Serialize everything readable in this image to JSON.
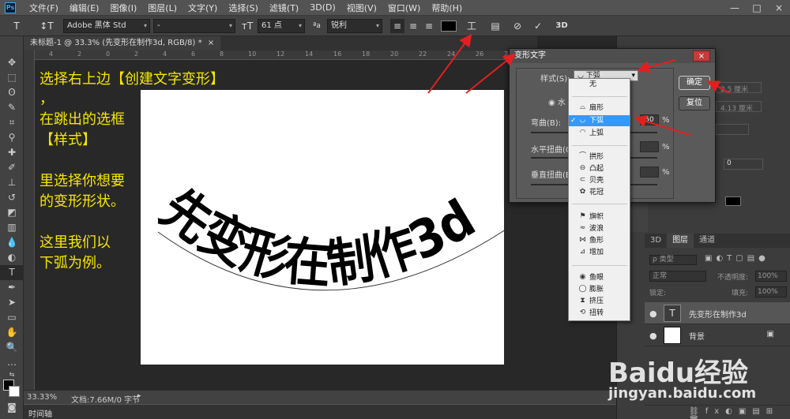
{
  "menubar": {
    "items": [
      "文件(F)",
      "编辑(E)",
      "图像(I)",
      "图层(L)",
      "文字(Y)",
      "选择(S)",
      "滤镜(T)",
      "3D(D)",
      "视图(V)",
      "窗口(W)",
      "帮助(H)"
    ],
    "app_badge": "Ps",
    "win_min": "—",
    "win_max": "□",
    "win_close": "×"
  },
  "options": {
    "font_family": "Adobe 黑体 Std",
    "font_style": "-",
    "font_size": "61 点",
    "aa_label": "ªa",
    "anti_alias": "锐利",
    "threed": "3D",
    "color_swatch": "#000000"
  },
  "document": {
    "tab_title": "未标题-1 @ 33.3% (先变形在制作3d, RGB/8) *",
    "close": "×",
    "zoom": "33.33%",
    "doc_info": "文档:7.66M/0 字节",
    "warped_text": "先变形在制作3d",
    "ruler_ticks": [
      "4",
      "2",
      "0",
      "2",
      "4",
      "6",
      "8",
      "10",
      "12",
      "14",
      "16",
      "18",
      "20",
      "22",
      "24",
      "26",
      "28",
      "30",
      "32",
      "34",
      "36"
    ]
  },
  "instructions": {
    "line1": "选择右上边【创建文字变形】",
    "line2": "，",
    "line3": "在跳出的选框",
    "line4": "【样式】",
    "line5": "里选择你想要",
    "line6": "的变形形状。",
    "line7": "这里我们以",
    "line8": "下弧为例。"
  },
  "dialog": {
    "title": "变形文字",
    "style_label": "样式(S):",
    "style_value": "下弧",
    "horizontal_label": "水",
    "bend_label": "弯曲(B):",
    "bend_value": "-50",
    "percent": "%",
    "h_distort_label": "水平扭曲(O",
    "v_distort_label": "垂直扭曲(E",
    "ok": "确定",
    "reset": "复位",
    "close": "×",
    "ghost_1": "2.5 厘米",
    "ghost_2": "4.13 厘米",
    "ghost_3": "0"
  },
  "style_menu": {
    "items": [
      {
        "label": "无",
        "icon": ""
      },
      {
        "label": "扇形",
        "icon": "⌓"
      },
      {
        "label": "下弧",
        "icon": "◡"
      },
      {
        "label": "上弧",
        "icon": "◠"
      },
      {
        "label": "拱形",
        "icon": "⌒"
      },
      {
        "label": "凸起",
        "icon": "⊖"
      },
      {
        "label": "贝壳",
        "icon": "⊂"
      },
      {
        "label": "花冠",
        "icon": "✿"
      },
      {
        "label": "旗帜",
        "icon": "⚑"
      },
      {
        "label": "波浪",
        "icon": "≈"
      },
      {
        "label": "鱼形",
        "icon": "⋈"
      },
      {
        "label": "增加",
        "icon": "⊿"
      },
      {
        "label": "鱼眼",
        "icon": "◉"
      },
      {
        "label": "膨胀",
        "icon": "◯"
      },
      {
        "label": "挤压",
        "icon": "⧗"
      },
      {
        "label": "扭转",
        "icon": "⟲"
      }
    ],
    "selected_index": 2,
    "check": "✓"
  },
  "panels": {
    "tab_3d": "3D",
    "tab_layers": "图层",
    "tab_channels": "通道",
    "kind_filter": "ρ 类型",
    "blend_mode": "正常",
    "opacity_label": "不透明度:",
    "opacity_value": "100%",
    "fill_label": "填充:",
    "fill_value": "100%",
    "lock_label": "锁定:",
    "layer_text": "先变形在制作3d",
    "layer_bg": "背景",
    "text_thumb": "T",
    "lock_icon": "🔒",
    "eye": "●",
    "fx": "fx"
  },
  "timeline": {
    "label": "时间轴"
  },
  "watermark": {
    "brand": "Baidu经验",
    "url": "jingyan.baidu.com"
  },
  "colors": {
    "note_yellow": "#f5e600",
    "arrow_red": "#e02020",
    "selection_blue": "#3399ff"
  }
}
